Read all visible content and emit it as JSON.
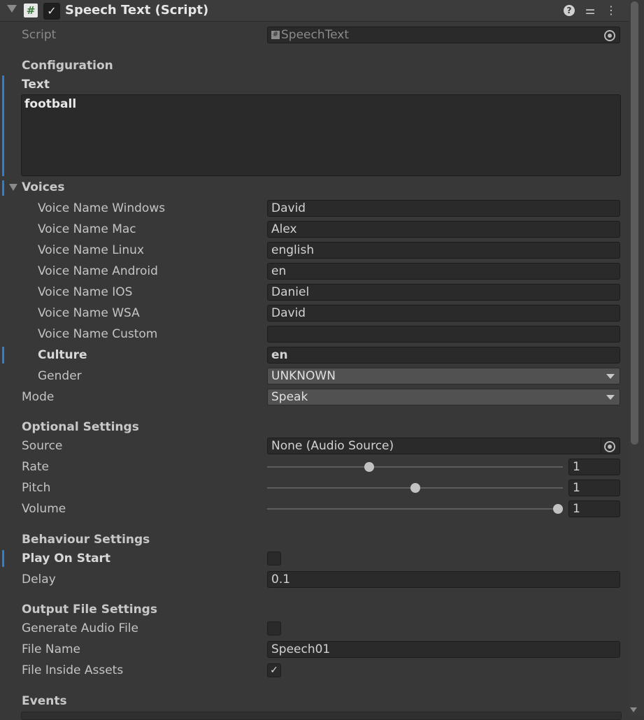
{
  "header": {
    "title": "Speech Text (Script)",
    "script_glyph": "#",
    "enabled_glyph": "✓",
    "help_glyph": "?",
    "presets_glyph": "⚌",
    "menu_glyph": "⋮"
  },
  "script": {
    "label": "Script",
    "value": "SpeechText",
    "glyph": "#"
  },
  "configuration": {
    "heading": "Configuration",
    "text_label": "Text",
    "text_value": "football"
  },
  "voices": {
    "heading": "Voices",
    "rows": [
      {
        "label": "Voice Name Windows",
        "value": "David"
      },
      {
        "label": "Voice Name Mac",
        "value": "Alex"
      },
      {
        "label": "Voice Name Linux",
        "value": "english"
      },
      {
        "label": "Voice Name Android",
        "value": "en"
      },
      {
        "label": "Voice Name IOS",
        "value": "Daniel"
      },
      {
        "label": "Voice Name WSA",
        "value": "David"
      },
      {
        "label": "Voice Name Custom",
        "value": ""
      },
      {
        "label": "Culture",
        "value": "en"
      }
    ],
    "gender_label": "Gender",
    "gender_value": "UNKNOWN"
  },
  "mode": {
    "label": "Mode",
    "value": "Speak"
  },
  "optional": {
    "heading": "Optional Settings",
    "source_label": "Source",
    "source_value": "None (Audio Source)",
    "rate_label": "Rate",
    "rate_value": "1",
    "rate_fraction": 0.34,
    "pitch_label": "Pitch",
    "pitch_value": "1",
    "pitch_fraction": 0.5,
    "volume_label": "Volume",
    "volume_value": "1",
    "volume_fraction": 1.0
  },
  "behaviour": {
    "heading": "Behaviour Settings",
    "play_label": "Play On Start",
    "play_checked": false,
    "delay_label": "Delay",
    "delay_value": "0.1"
  },
  "output": {
    "heading": "Output File Settings",
    "generate_label": "Generate Audio File",
    "generate_checked": false,
    "filename_label": "File Name",
    "filename_value": "Speech01",
    "inside_label": "File Inside Assets",
    "inside_checked": true,
    "check_glyph": "✓"
  },
  "events": {
    "heading": "Events"
  },
  "colors": {
    "background": "#383838",
    "field": "#2a2a2a",
    "accent": "#2a7fd0"
  }
}
